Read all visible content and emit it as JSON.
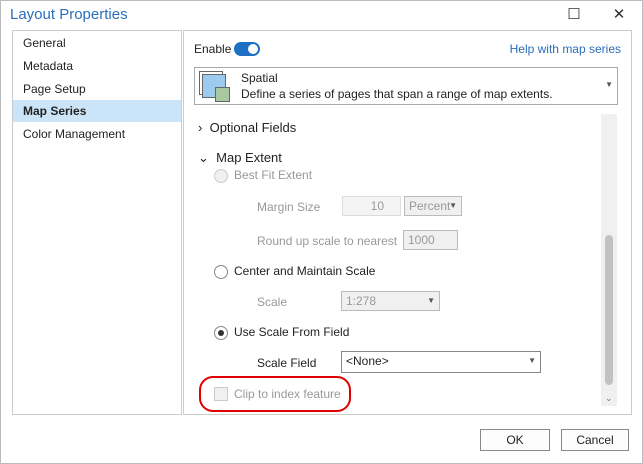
{
  "window": {
    "title": "Layout Properties",
    "minimize": "☐",
    "close": "✕"
  },
  "sidebar": {
    "items": [
      {
        "label": "General"
      },
      {
        "label": "Metadata"
      },
      {
        "label": "Page Setup"
      },
      {
        "label": "Map Series"
      },
      {
        "label": "Color Management"
      }
    ]
  },
  "header": {
    "enable_label": "Enable",
    "enabled": true,
    "help_link": "Help with map series"
  },
  "series_type": {
    "title": "Spatial",
    "description": "Define a series of pages that span a range of map extents."
  },
  "sections": {
    "optional_fields": "Optional Fields",
    "map_extent": "Map Extent"
  },
  "extent": {
    "best_fit": "Best Fit Extent",
    "margin_label": "Margin Size",
    "margin_value": "10",
    "margin_unit": "Percent",
    "round_label": "Round up scale to nearest",
    "round_value": "1000",
    "center": "Center and Maintain Scale",
    "scale_label": "Scale",
    "scale_value": "1:278",
    "use_field": "Use Scale From Field",
    "field_label": "Scale Field",
    "field_value": "<None>",
    "clip": "Clip to index feature"
  },
  "footer": {
    "ok": "OK",
    "cancel": "Cancel"
  },
  "colors": {
    "accent": "#1d6fc4",
    "selected": "#cce4f7",
    "annotation": "#e00000"
  }
}
